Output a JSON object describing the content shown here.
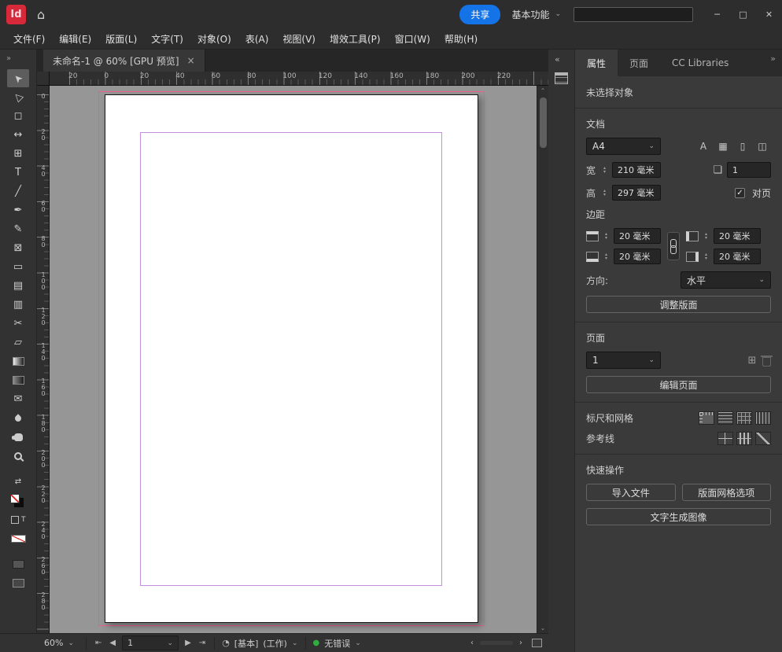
{
  "titlebar": {
    "app_logo": "Id",
    "share_button": "共享",
    "workspace_switcher": "基本功能"
  },
  "menubar": {
    "items": [
      "文件(F)",
      "编辑(E)",
      "版面(L)",
      "文字(T)",
      "对象(O)",
      "表(A)",
      "视图(V)",
      "增效工具(P)",
      "窗口(W)",
      "帮助(H)"
    ]
  },
  "document_tab": {
    "title": "未命名-1 @ 60% [GPU 预览]"
  },
  "toolbar": {
    "tools": [
      {
        "name": "selection-tool",
        "glyph": "➤",
        "rot": true,
        "active": true
      },
      {
        "name": "direct-selection-tool",
        "glyph": "▷",
        "rot": true
      },
      {
        "name": "page-tool",
        "glyph": "◻"
      },
      {
        "name": "gap-tool",
        "glyph": "↔"
      },
      {
        "name": "content-collector-tool",
        "glyph": "⊞"
      },
      {
        "name": "type-tool",
        "glyph": "T"
      },
      {
        "name": "line-tool",
        "glyph": "╱"
      },
      {
        "name": "pen-tool",
        "glyph": "✒"
      },
      {
        "name": "pencil-tool",
        "glyph": "✎"
      },
      {
        "name": "rectangle-frame-tool",
        "glyph": "⊠"
      },
      {
        "name": "rectangle-tool",
        "glyph": "▭"
      },
      {
        "name": "horizontal-grid-tool",
        "glyph": "▤"
      },
      {
        "name": "vertical-grid-tool",
        "glyph": "▥"
      },
      {
        "name": "scissors-tool",
        "glyph": "✂"
      },
      {
        "name": "free-transform-tool",
        "glyph": "▱"
      },
      {
        "name": "gradient-swatch-tool",
        "cls": "ticon-gradient"
      },
      {
        "name": "gradient-feather-tool",
        "cls": "ticon-feather"
      },
      {
        "name": "note-tool",
        "glyph": "✉"
      },
      {
        "name": "eyedropper-tool",
        "cls": "ticon-dropper"
      },
      {
        "name": "hand-tool",
        "cls": "ticon-hand"
      },
      {
        "name": "zoom-tool",
        "cls": "ticon-zoom"
      },
      {
        "name": "swap-fill-stroke-icon",
        "glyph": "⇄",
        "gap": true,
        "small": true
      },
      {
        "name": "fill-stroke-swatches",
        "cls": "ticon-fillstroke"
      },
      {
        "name": "formatting-affects-icon",
        "cls": "ticon-fmt"
      },
      {
        "name": "apply-none-swatch",
        "cls": "ticon-none"
      },
      {
        "name": "normal-view-icon",
        "cls": "ticon-dark",
        "gap": true
      },
      {
        "name": "screen-mode-icon",
        "cls": "ticon-screen"
      }
    ]
  },
  "rulers": {
    "horizontal_labels": [
      "20",
      "0",
      "20",
      "40",
      "60",
      "80",
      "100",
      "120",
      "140",
      "160",
      "180",
      "200",
      "220"
    ],
    "vertical_labels": [
      "0",
      "20",
      "40",
      "60",
      "80",
      "100",
      "120",
      "140",
      "160",
      "180",
      "200",
      "220",
      "240",
      "260",
      "280"
    ]
  },
  "panel": {
    "tabs": [
      {
        "label": "属性",
        "active": true
      },
      {
        "label": "页面",
        "active": false
      },
      {
        "label": "CC Libraries",
        "active": false
      }
    ],
    "no_selection": "未选择对象",
    "document": {
      "section_label": "文档",
      "preset": "A4",
      "preset_buttons": [
        {
          "name": "document-setup-icon",
          "glyph": "A"
        },
        {
          "name": "layout-grid-icon",
          "glyph": "▦"
        },
        {
          "name": "margins-columns-icon",
          "glyph": "▯"
        },
        {
          "name": "bleed-slug-icon",
          "glyph": "◫"
        }
      ],
      "width_label": "宽",
      "width_value": "210 毫米",
      "height_label": "高",
      "height_value": "297 毫米",
      "pages_value": "1",
      "facing_pages_label": "对页"
    },
    "margins": {
      "section_label": "边距",
      "top": "20 毫米",
      "bottom": "20 毫米",
      "inside": "20 毫米",
      "outside": "20 毫米"
    },
    "orientation": {
      "label": "方向:",
      "value": "水平"
    },
    "adjust_layout_button": "调整版面",
    "pages": {
      "section_label": "页面",
      "current_page": "1",
      "edit_pages_button": "编辑页面"
    },
    "rulers_grids": {
      "label": "标尺和网格",
      "buttons": [
        {
          "name": "frame-grid-options-icon",
          "cls": "gi-ruler",
          "active": true
        },
        {
          "name": "baseline-grid-icon",
          "cls": "gi-baseline"
        },
        {
          "name": "document-grid-icon",
          "cls": "gi-docgrid"
        },
        {
          "name": "vertical-grid-icon",
          "cls": "gi-vgrid"
        }
      ]
    },
    "guides": {
      "label": "参考线",
      "buttons": [
        {
          "name": "create-guides-icon",
          "cls": "gi-guides"
        },
        {
          "name": "smart-guides-icon",
          "cls": "gi-smart"
        },
        {
          "name": "guide-options-icon",
          "cls": "gi-edit"
        }
      ]
    },
    "quick_actions": {
      "section_label": "快速操作",
      "import_button": "导入文件",
      "layout_grid_button": "版面网格选项",
      "text_to_image_button": "文字生成图像"
    }
  },
  "statusbar": {
    "zoom": "60%",
    "page": "1",
    "preflight_profile": "[基本]",
    "preflight_scope": "(工作)",
    "errors": "无错误"
  },
  "icons": {
    "home": "⌂",
    "chevron_down": "⌄",
    "spin_up": "▴",
    "spin_down": "▾",
    "minimize": "─",
    "maximize": "□",
    "close": "✕",
    "tab_close": "×",
    "collapse_left": "«",
    "panel_menu": "»",
    "toolbar_expand": "»",
    "scroll_up": "⌃",
    "scroll_down": "⌄",
    "scroll_left": "‹",
    "scroll_right": "›",
    "first_page": "⇤",
    "prev_page": "◀",
    "next_page": "▶",
    "last_page": "⇥",
    "preflight_clock": "◔",
    "status_dot": "●",
    "check": "✓",
    "add_page": "⊞",
    "pages_stack": "❏"
  },
  "colors": {
    "accent": "#1473e6",
    "logo_red": "#d6293a",
    "page_guide_pink": "#ec5f8a",
    "margin_guide_violet": "#c48fdd",
    "error_green": "#2fae3e"
  }
}
